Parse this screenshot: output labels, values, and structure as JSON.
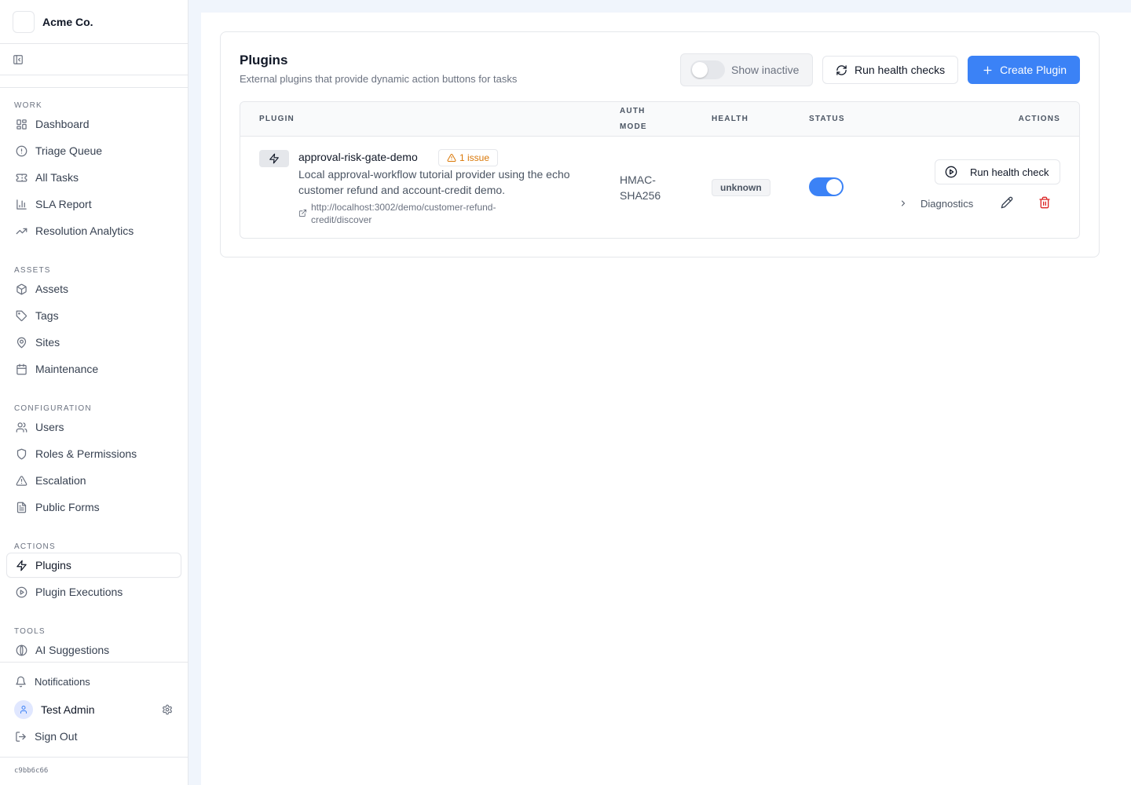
{
  "brand": {
    "name": "Acme Co."
  },
  "sidebar": {
    "sections": [
      {
        "title": "WORK",
        "items": [
          {
            "label": "Dashboard",
            "icon": "dashboard-icon"
          },
          {
            "label": "Triage Queue",
            "icon": "alert-circle-icon"
          },
          {
            "label": "All Tasks",
            "icon": "ticket-icon"
          },
          {
            "label": "SLA Report",
            "icon": "bar-chart-icon"
          },
          {
            "label": "Resolution Analytics",
            "icon": "trending-up-icon"
          }
        ]
      },
      {
        "title": "ASSETS",
        "items": [
          {
            "label": "Assets",
            "icon": "package-icon"
          },
          {
            "label": "Tags",
            "icon": "tag-icon"
          },
          {
            "label": "Sites",
            "icon": "map-pin-icon"
          },
          {
            "label": "Maintenance",
            "icon": "calendar-icon"
          }
        ]
      },
      {
        "title": "CONFIGURATION",
        "items": [
          {
            "label": "Users",
            "icon": "users-icon"
          },
          {
            "label": "Roles & Permissions",
            "icon": "shield-icon"
          },
          {
            "label": "Escalation",
            "icon": "triangle-alert-icon"
          },
          {
            "label": "Public Forms",
            "icon": "file-text-icon"
          }
        ]
      },
      {
        "title": "ACTIONS",
        "items": [
          {
            "label": "Plugins",
            "icon": "zap-icon",
            "active": true
          },
          {
            "label": "Plugin Executions",
            "icon": "play-circle-icon"
          }
        ]
      },
      {
        "title": "TOOLS",
        "items": [
          {
            "label": "AI Suggestions",
            "icon": "ai-icon"
          }
        ]
      }
    ],
    "footer": {
      "notifications_label": "Notifications",
      "user_name": "Test Admin",
      "sign_out_label": "Sign Out",
      "version": "c9bb6c66"
    }
  },
  "page": {
    "title": "Plugins",
    "subtitle": "External plugins that provide dynamic action buttons for tasks",
    "show_inactive_label": "Show inactive",
    "show_inactive_on": false,
    "run_health_checks_label": "Run health checks",
    "create_plugin_label": "Create Plugin"
  },
  "table": {
    "headers": {
      "plugin": "PLUGIN",
      "auth_mode_1": "AUTH",
      "auth_mode_2": "MODE",
      "health": "HEALTH",
      "status": "STATUS",
      "actions": "ACTIONS"
    },
    "rows": [
      {
        "name": "approval-risk-gate-demo",
        "issue_badge": "1 issue",
        "description": "Local approval-workflow tutorial provider using the echo customer refund and account-credit demo.",
        "url": "http://localhost:3002/demo/customer-refund-credit/discover",
        "auth_mode": "HMAC-SHA256",
        "health": "unknown",
        "status_active": true,
        "run_health_check_label": "Run health check",
        "diagnostics_label": "Diagnostics"
      }
    ]
  },
  "colors": {
    "primary": "#3b82f6",
    "warning": "#d97706",
    "danger": "#dc2626",
    "main_bg": "#f0f5fc"
  }
}
